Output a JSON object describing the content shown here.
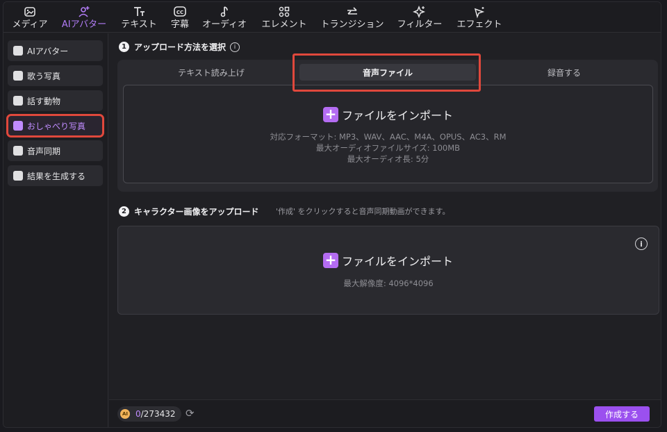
{
  "toolbar": {
    "items": [
      {
        "label": "メディア",
        "icon": "media-icon"
      },
      {
        "label": "AIアバター",
        "icon": "avatar-icon",
        "active": true
      },
      {
        "label": "テキスト",
        "icon": "text-icon"
      },
      {
        "label": "字幕",
        "icon": "caption-icon"
      },
      {
        "label": "オーディオ",
        "icon": "music-note-icon"
      },
      {
        "label": "エレメント",
        "icon": "element-icon"
      },
      {
        "label": "トランジション",
        "icon": "transition-icon"
      },
      {
        "label": "フィルター",
        "icon": "filter-icon"
      },
      {
        "label": "エフェクト",
        "icon": "effect-icon"
      }
    ]
  },
  "sidebar": {
    "items": [
      {
        "label": "AIアバター"
      },
      {
        "label": "歌う写真"
      },
      {
        "label": "話す動物"
      },
      {
        "label": "おしゃべり写真",
        "active": true
      },
      {
        "label": "音声同期"
      },
      {
        "label": "結果を生成する"
      }
    ]
  },
  "step1": {
    "number": "1",
    "title": "アップロード方法を選択",
    "tabs": [
      "テキスト読み上げ",
      "音声ファイル",
      "録音する"
    ],
    "active_tab": "音声ファイル",
    "import_label": "ファイルをインポート",
    "formats": "対応フォーマット: MP3、WAV、AAC、M4A、OPUS、AC3、RM",
    "max_size": "最大オーディオファイルサイズ: 100MB",
    "max_length": "最大オーディオ長: 5分"
  },
  "step2": {
    "number": "2",
    "title": "キャラクター画像をアップロード",
    "hint": "'作成' をクリックすると音声同期動画ができます。",
    "import_label": "ファイルをインポート",
    "max_resolution": "最大解像度: 4096*4096"
  },
  "footer": {
    "credit_used": "0",
    "credit_total": "/273432",
    "coin_label": "AI",
    "create_label": "作成する"
  },
  "colors": {
    "accent": "#9b50ef",
    "highlight": "#e0483c"
  }
}
